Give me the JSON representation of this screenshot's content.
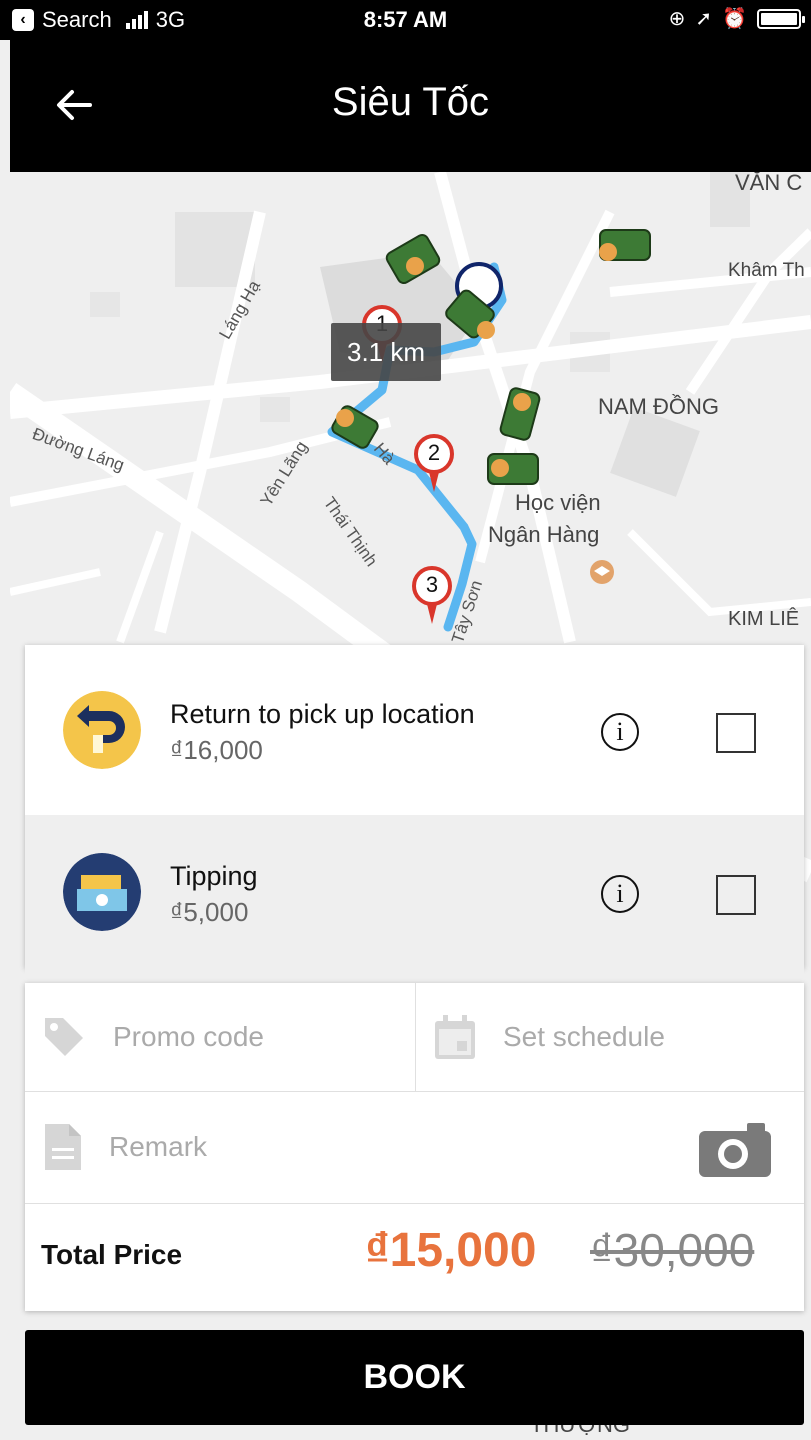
{
  "status_bar": {
    "back_app": "Search",
    "network": "3G",
    "time": "8:57 AM"
  },
  "nav": {
    "title": "Siêu Tốc"
  },
  "map": {
    "labels": {
      "van_chuong": "VĂN C",
      "kham_thien": "Khâm Th",
      "lang_ha": "Láng Hạ",
      "nam_dong": "NAM ĐỒNG",
      "duong_lang": "Đường Láng",
      "yen_lang": "Yên Lãng",
      "ha": "Hà",
      "thai_thinh": "Thái Thịnh",
      "hoc_vien": "Học viện",
      "ngan_hang": "Ngân Hàng",
      "kim_lien": "KIM LIÊ",
      "tay_son": "Tây Sơn",
      "thuong": "THƯỢNG"
    },
    "distance": "3.1 km",
    "markers": [
      "1",
      "2",
      "3"
    ]
  },
  "options": [
    {
      "title": "Return to pick up location",
      "price": "₫16,000",
      "icon": "return-trip-icon",
      "checked": false
    },
    {
      "title": "Tipping",
      "price": "₫5,000",
      "icon": "tipping-money-icon",
      "checked": false
    }
  ],
  "extras": {
    "promo_placeholder": "Promo code",
    "schedule_placeholder": "Set schedule",
    "remark_placeholder": "Remark"
  },
  "total": {
    "label": "Total Price",
    "price": "₫15,000",
    "original_price": "₫30,000"
  },
  "book_label": "BOOK",
  "colors": {
    "accent": "#e8733d",
    "route": "#5ab6f0",
    "marker": "#d9362b"
  }
}
